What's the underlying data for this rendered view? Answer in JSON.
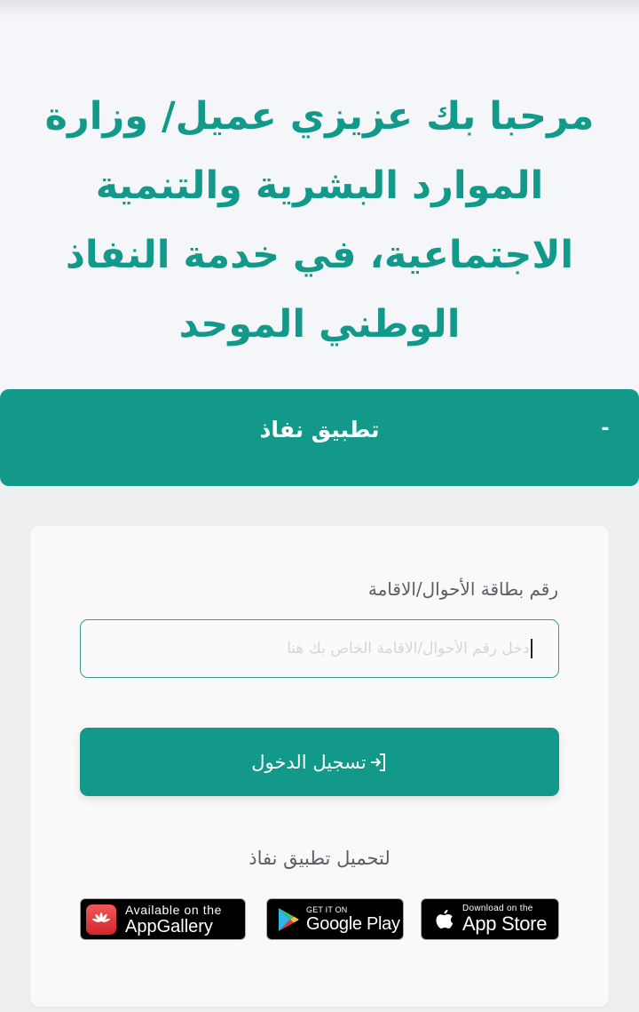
{
  "hero": {
    "title": "مرحبا بك عزيزي عميل/ وزارة الموارد البشرية والتنمية الاجتماعية، في خدمة النفاذ الوطني الموحد"
  },
  "accordion": {
    "title": "تطبيق نفاذ",
    "toggle": "-",
    "expanded": true
  },
  "form": {
    "id_label": "رقم بطاقة الأحوال/الاقامة",
    "id_placeholder": "ادخل رقم الأحوال/الاقامة الخاص بك هنا",
    "id_value": "",
    "login_label": "تسجيل الدخول",
    "login_icon": "login-icon"
  },
  "download": {
    "label": "لتحميل تطبيق نفاذ",
    "badges": [
      {
        "store": "AppGallery",
        "small": "Available on the",
        "big": "AppGallery",
        "icon": "huawei-icon"
      },
      {
        "store": "Google Play",
        "small": "GET IT ON",
        "big": "Google Play",
        "icon": "google-play-icon"
      },
      {
        "store": "App Store",
        "small": "Download on the",
        "big": "App Store",
        "icon": "apple-icon"
      }
    ]
  },
  "colors": {
    "primary": "#13998a",
    "page_bg": "#f5f6f9",
    "card_bg": "#f9f9f9",
    "text_muted": "#5a5f66"
  }
}
